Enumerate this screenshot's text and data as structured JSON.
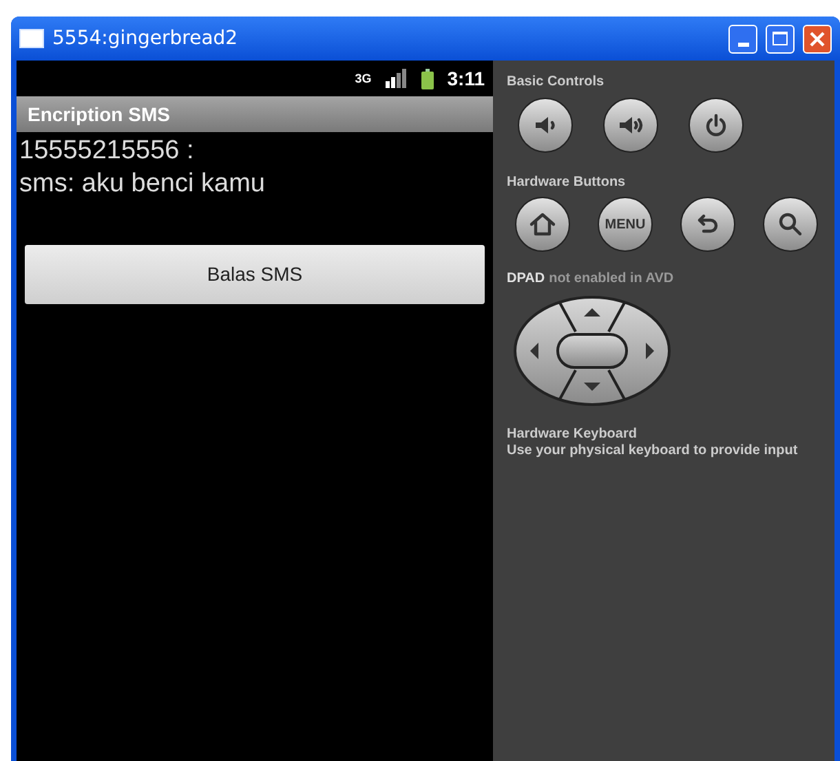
{
  "window": {
    "title": "5554:gingerbread2"
  },
  "status_bar": {
    "network_type": "3G",
    "time": "3:11"
  },
  "app": {
    "title": "Encription SMS",
    "sender": "15555215556 :",
    "message": "sms: aku benci kamu",
    "reply_button": "Balas SMS"
  },
  "controls": {
    "basic_title": "Basic Controls",
    "basic_buttons": [
      {
        "kind": "volume-down"
      },
      {
        "kind": "volume-up"
      },
      {
        "kind": "power"
      }
    ],
    "hardware_title": "Hardware Buttons",
    "hardware_buttons": [
      {
        "kind": "home"
      },
      {
        "kind": "menu",
        "label": "MENU"
      },
      {
        "kind": "back"
      },
      {
        "kind": "search"
      }
    ],
    "dpad_label": "DPAD",
    "dpad_note": "not enabled in AVD",
    "keyboard_title": "Hardware Keyboard",
    "keyboard_note": "Use your physical keyboard to provide input"
  }
}
